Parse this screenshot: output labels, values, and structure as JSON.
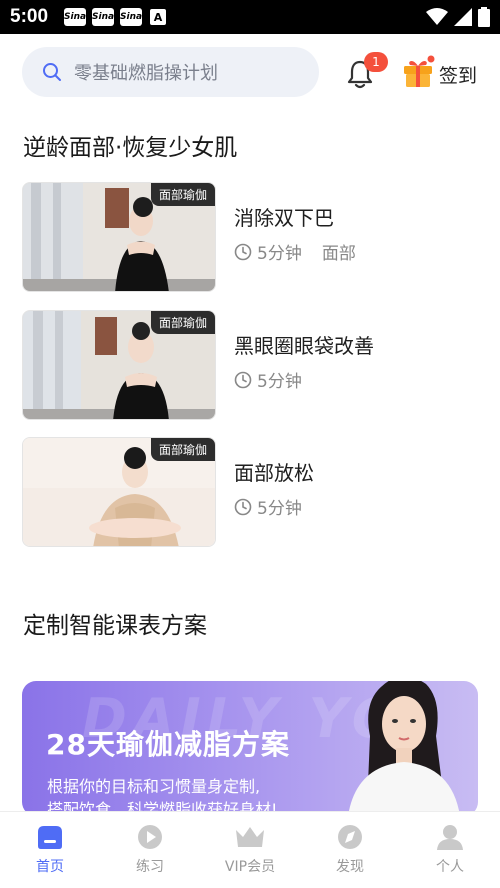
{
  "status_bar": {
    "time": "5:00",
    "notifications": [
      "Sina",
      "Sina",
      "Sina",
      "A"
    ]
  },
  "header": {
    "search_placeholder": "零基础燃脂操计划",
    "notification_badge": "1",
    "checkin_label": "签到"
  },
  "section1": {
    "title": "逆龄面部·恢复少女肌",
    "courses": [
      {
        "tag": "面部瑜伽",
        "title": "消除双下巴",
        "duration": "5分钟",
        "category": "面部"
      },
      {
        "tag": "面部瑜伽",
        "title": "黑眼圈眼袋改善",
        "duration": "5分钟",
        "category": ""
      },
      {
        "tag": "面部瑜伽",
        "title": "面部放松",
        "duration": "5分钟",
        "category": ""
      }
    ]
  },
  "section2": {
    "title": "定制智能课表方案",
    "banner": {
      "watermark": "DAILY YO",
      "headline": "28天瑜伽减脂方案",
      "line1": "根据你的目标和习惯量身定制,",
      "line2": "搭配饮食、科学燃脂收获好身材!"
    }
  },
  "tabs": [
    {
      "label": "首页",
      "icon": "home-icon",
      "active": true
    },
    {
      "label": "练习",
      "icon": "play-icon",
      "active": false
    },
    {
      "label": "VIP会员",
      "icon": "crown-icon",
      "active": false
    },
    {
      "label": "发现",
      "icon": "compass-icon",
      "active": false
    },
    {
      "label": "个人",
      "icon": "person-icon",
      "active": false
    }
  ],
  "colors": {
    "accent": "#4f6cf5",
    "badge": "#f4503c",
    "banner_start": "#8a73e8",
    "banner_end": "#c8bcf3"
  }
}
